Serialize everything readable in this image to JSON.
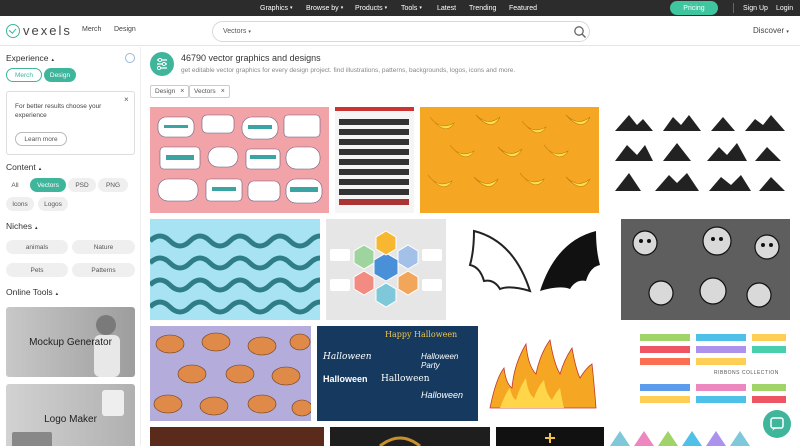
{
  "topnav": {
    "items": [
      {
        "label": "Graphics",
        "caret": "▾"
      },
      {
        "label": "Browse by",
        "caret": "▾"
      },
      {
        "label": "Products",
        "caret": "▾"
      },
      {
        "label": "Tools",
        "caret": "▾"
      },
      {
        "label": "Latest"
      },
      {
        "label": "Trending"
      },
      {
        "label": "Featured"
      }
    ],
    "pricing": "Pricing",
    "signup": "Sign Up",
    "login": "Login"
  },
  "header": {
    "logo": "vexels",
    "merch": "Merch",
    "design": "Design",
    "search_category": "Vectors",
    "search_caret": "▾",
    "search_placeholder": "",
    "discover": "Discover",
    "discover_caret": "▾"
  },
  "sidebar": {
    "experience": {
      "title": "Experience",
      "caret": "▴",
      "merch": "Merch",
      "design": "Design"
    },
    "tip": {
      "text": "For better results choose your experience",
      "close": "×",
      "button": "Learn more"
    },
    "content": {
      "title": "Content",
      "caret": "▴",
      "options": [
        "All",
        "Vectors",
        "PSD",
        "PNG",
        "Icons",
        "Logos"
      ]
    },
    "niches": {
      "title": "Niches",
      "caret": "▴",
      "options": [
        "animals",
        "Nature",
        "Pets",
        "Patterns"
      ]
    },
    "online_tools": {
      "title": "Online Tools",
      "caret": "▴",
      "tools": [
        "Mockup Generator",
        "Logo Maker"
      ]
    }
  },
  "main": {
    "title": "46790 vector graphics and designs",
    "subtitle": "get editable vector graphics for every design project. find illustrations, patterns, backgrounds, logos, icons and more.",
    "tags": [
      {
        "label": "Design",
        "x": "×"
      },
      {
        "label": "Vectors",
        "x": "×"
      }
    ],
    "tiles": [
      {
        "name": "lettering-stickers",
        "bg": "#f1a3a8"
      },
      {
        "name": "silhouettes-pack",
        "bg": "#f5f5f5"
      },
      {
        "name": "banana-pattern",
        "bg": "#f5a623"
      },
      {
        "name": "mountain-icons",
        "bg": "#ffffff"
      },
      {
        "name": "wave-pattern",
        "bg": "#a8e3f3"
      },
      {
        "name": "hexagon-infographic",
        "bg": "#e6e6e6"
      },
      {
        "name": "wings-silhouette",
        "bg": "#ffffff"
      },
      {
        "name": "retro-cartoons",
        "bg": "#5e5e5e"
      },
      {
        "name": "cat-pattern",
        "bg": "#b4addc"
      },
      {
        "name": "halloween-lettering",
        "bg": "#163a5f"
      },
      {
        "name": "fire-flames",
        "bg": "#ffffff"
      },
      {
        "name": "ribbons-collection",
        "bg": "#ffffff"
      }
    ],
    "watermark": "vexels",
    "halloween": [
      "Happy Halloween",
      "Halloween",
      "Halloween",
      "Halloween",
      "Halloween Party",
      "Halloween"
    ],
    "ribbons_label": "RIBBONS COLLECTION"
  },
  "colors": {
    "accent": "#3fb59b",
    "topbar": "#2c2c2c"
  }
}
